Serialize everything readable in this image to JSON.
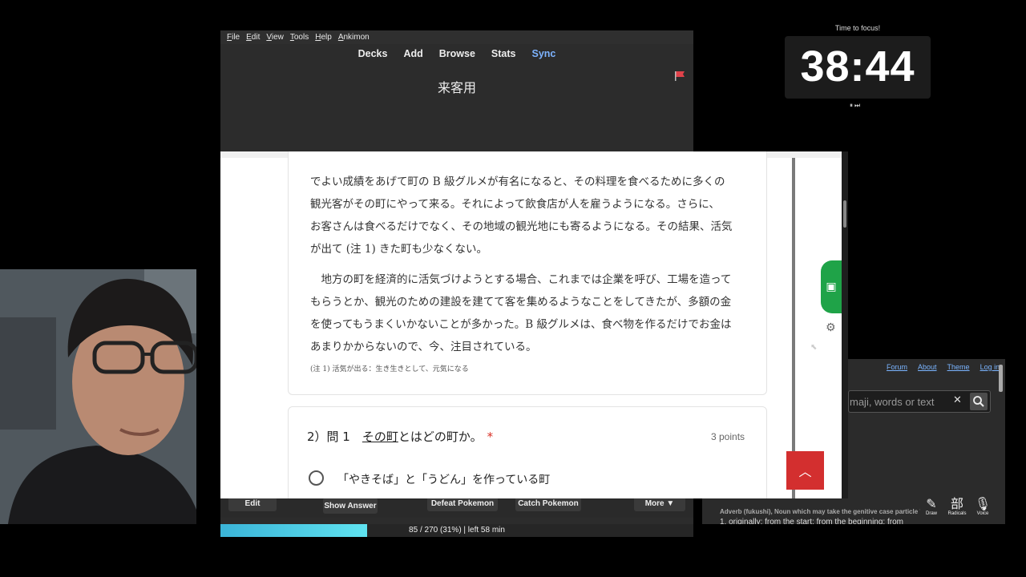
{
  "anki": {
    "menu": [
      "File",
      "Edit",
      "View",
      "Tools",
      "Help",
      "Ankimon"
    ],
    "nav": [
      "Decks",
      "Add",
      "Browse",
      "Stats",
      "Sync"
    ],
    "deck_title": "来客用",
    "buttons": {
      "edit": "Edit",
      "show_answer": "Show Answer",
      "defeat": "Defeat Pokemon",
      "catch": "Catch Pokemon",
      "more": "More ▼"
    },
    "progress": {
      "text": "85 / 270 (31%) | left 58 min",
      "fraction": 0.31
    }
  },
  "form": {
    "passage": [
      "でよい成績をあげて町の B 級グルメが有名になると、その料理を食べるために多くの",
      "観光客がその町にやって来る。それによって飲食店が人を雇うようになる。さらに、",
      "お客さんは食べるだけでなく、その地域の観光地にも寄るようになる。その結果、活気",
      "が出て (注 1) きた町も少なくない。"
    ],
    "passage2": [
      "　地方の町を経済的に活気づけようとする場合、これまでは企業を呼び、工場を造って",
      "もらうとか、観光のための建設を建てて客を集めるようなことをしてきたが、多額の金",
      "を使ってもうまくいかないことが多かった。B 級グルメは、食べ物を作るだけでお金は",
      "あまりかからないので、今、注目されている。"
    ],
    "note": "(注 1) 活気が出る：生き生きとして、元気になる",
    "question": {
      "prefix": "2）問 1　",
      "underlined": "その町",
      "rest": "とはどの町か。",
      "required": "*"
    },
    "points": "3 points",
    "option1": "「やきそば」と「うどん」を作っている町"
  },
  "timer": {
    "label": "Time to focus!",
    "value": "38:44",
    "controls": "⏸⏭"
  },
  "jisho": {
    "nav": [
      "Forum",
      "About",
      "Theme",
      "Log in"
    ],
    "search_placeholder": "maji, words or text",
    "definition_head": "Adverb (fukushi), Noun which may take the genitive case particle 'no'",
    "definition_line": "1.  originally; from the start; from the beginning; from",
    "tools": [
      "Draw",
      "Radicals",
      "Voice"
    ]
  },
  "colors": {
    "accent_sync": "#7db3ff",
    "scroll_top_red": "#d32f2f",
    "progress": "#5fe3f0",
    "tab_green": "#1fa348"
  }
}
